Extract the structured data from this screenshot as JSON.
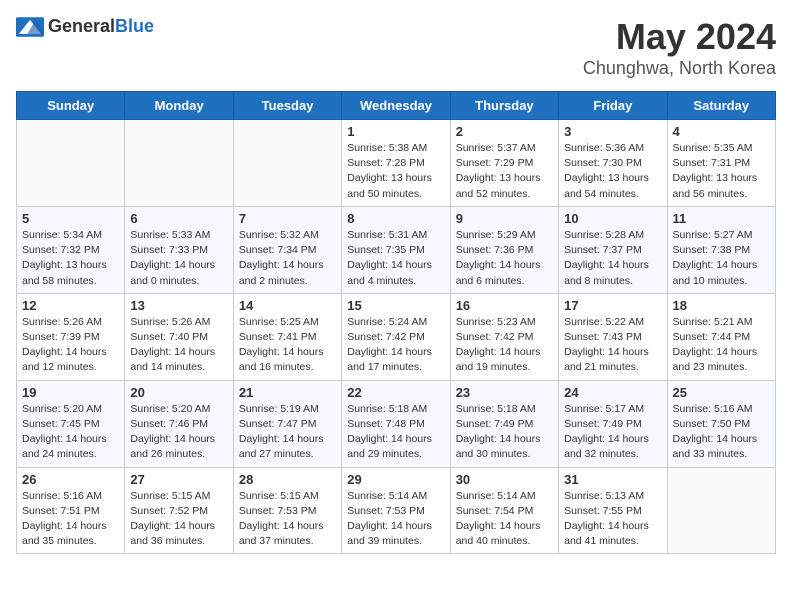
{
  "header": {
    "logo_general": "General",
    "logo_blue": "Blue",
    "title": "May 2024",
    "location": "Chunghwa, North Korea"
  },
  "weekdays": [
    "Sunday",
    "Monday",
    "Tuesday",
    "Wednesday",
    "Thursday",
    "Friday",
    "Saturday"
  ],
  "weeks": [
    [
      {
        "day": "",
        "content": ""
      },
      {
        "day": "",
        "content": ""
      },
      {
        "day": "",
        "content": ""
      },
      {
        "day": "1",
        "content": "Sunrise: 5:38 AM\nSunset: 7:28 PM\nDaylight: 13 hours\nand 50 minutes."
      },
      {
        "day": "2",
        "content": "Sunrise: 5:37 AM\nSunset: 7:29 PM\nDaylight: 13 hours\nand 52 minutes."
      },
      {
        "day": "3",
        "content": "Sunrise: 5:36 AM\nSunset: 7:30 PM\nDaylight: 13 hours\nand 54 minutes."
      },
      {
        "day": "4",
        "content": "Sunrise: 5:35 AM\nSunset: 7:31 PM\nDaylight: 13 hours\nand 56 minutes."
      }
    ],
    [
      {
        "day": "5",
        "content": "Sunrise: 5:34 AM\nSunset: 7:32 PM\nDaylight: 13 hours\nand 58 minutes."
      },
      {
        "day": "6",
        "content": "Sunrise: 5:33 AM\nSunset: 7:33 PM\nDaylight: 14 hours\nand 0 minutes."
      },
      {
        "day": "7",
        "content": "Sunrise: 5:32 AM\nSunset: 7:34 PM\nDaylight: 14 hours\nand 2 minutes."
      },
      {
        "day": "8",
        "content": "Sunrise: 5:31 AM\nSunset: 7:35 PM\nDaylight: 14 hours\nand 4 minutes."
      },
      {
        "day": "9",
        "content": "Sunrise: 5:29 AM\nSunset: 7:36 PM\nDaylight: 14 hours\nand 6 minutes."
      },
      {
        "day": "10",
        "content": "Sunrise: 5:28 AM\nSunset: 7:37 PM\nDaylight: 14 hours\nand 8 minutes."
      },
      {
        "day": "11",
        "content": "Sunrise: 5:27 AM\nSunset: 7:38 PM\nDaylight: 14 hours\nand 10 minutes."
      }
    ],
    [
      {
        "day": "12",
        "content": "Sunrise: 5:26 AM\nSunset: 7:39 PM\nDaylight: 14 hours\nand 12 minutes."
      },
      {
        "day": "13",
        "content": "Sunrise: 5:26 AM\nSunset: 7:40 PM\nDaylight: 14 hours\nand 14 minutes."
      },
      {
        "day": "14",
        "content": "Sunrise: 5:25 AM\nSunset: 7:41 PM\nDaylight: 14 hours\nand 16 minutes."
      },
      {
        "day": "15",
        "content": "Sunrise: 5:24 AM\nSunset: 7:42 PM\nDaylight: 14 hours\nand 17 minutes."
      },
      {
        "day": "16",
        "content": "Sunrise: 5:23 AM\nSunset: 7:42 PM\nDaylight: 14 hours\nand 19 minutes."
      },
      {
        "day": "17",
        "content": "Sunrise: 5:22 AM\nSunset: 7:43 PM\nDaylight: 14 hours\nand 21 minutes."
      },
      {
        "day": "18",
        "content": "Sunrise: 5:21 AM\nSunset: 7:44 PM\nDaylight: 14 hours\nand 23 minutes."
      }
    ],
    [
      {
        "day": "19",
        "content": "Sunrise: 5:20 AM\nSunset: 7:45 PM\nDaylight: 14 hours\nand 24 minutes."
      },
      {
        "day": "20",
        "content": "Sunrise: 5:20 AM\nSunset: 7:46 PM\nDaylight: 14 hours\nand 26 minutes."
      },
      {
        "day": "21",
        "content": "Sunrise: 5:19 AM\nSunset: 7:47 PM\nDaylight: 14 hours\nand 27 minutes."
      },
      {
        "day": "22",
        "content": "Sunrise: 5:18 AM\nSunset: 7:48 PM\nDaylight: 14 hours\nand 29 minutes."
      },
      {
        "day": "23",
        "content": "Sunrise: 5:18 AM\nSunset: 7:49 PM\nDaylight: 14 hours\nand 30 minutes."
      },
      {
        "day": "24",
        "content": "Sunrise: 5:17 AM\nSunset: 7:49 PM\nDaylight: 14 hours\nand 32 minutes."
      },
      {
        "day": "25",
        "content": "Sunrise: 5:16 AM\nSunset: 7:50 PM\nDaylight: 14 hours\nand 33 minutes."
      }
    ],
    [
      {
        "day": "26",
        "content": "Sunrise: 5:16 AM\nSunset: 7:51 PM\nDaylight: 14 hours\nand 35 minutes."
      },
      {
        "day": "27",
        "content": "Sunrise: 5:15 AM\nSunset: 7:52 PM\nDaylight: 14 hours\nand 36 minutes."
      },
      {
        "day": "28",
        "content": "Sunrise: 5:15 AM\nSunset: 7:53 PM\nDaylight: 14 hours\nand 37 minutes."
      },
      {
        "day": "29",
        "content": "Sunrise: 5:14 AM\nSunset: 7:53 PM\nDaylight: 14 hours\nand 39 minutes."
      },
      {
        "day": "30",
        "content": "Sunrise: 5:14 AM\nSunset: 7:54 PM\nDaylight: 14 hours\nand 40 minutes."
      },
      {
        "day": "31",
        "content": "Sunrise: 5:13 AM\nSunset: 7:55 PM\nDaylight: 14 hours\nand 41 minutes."
      },
      {
        "day": "",
        "content": ""
      }
    ]
  ]
}
